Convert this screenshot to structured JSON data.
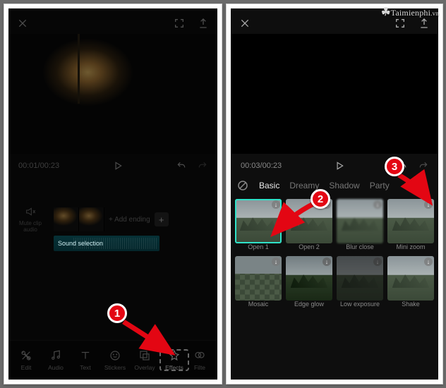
{
  "watermark": "Taimienphi",
  "watermark_suffix": ".vn",
  "left": {
    "time_current": "00:01",
    "time_total": "00:23",
    "mute_label": "Mute clip audio",
    "add_ending": "+ Add ending",
    "audio_clip_label": "Sound selection",
    "tools": {
      "edit": "Edit",
      "audio": "Audio",
      "text": "Text",
      "stickers": "Stickers",
      "overlay": "Overlay",
      "effects": "Effects",
      "filter": "Filte"
    }
  },
  "right": {
    "time_current": "00:03",
    "time_total": "00:23",
    "categories": {
      "basic": "Basic",
      "dreamy": "Dreamy",
      "shadow": "Shadow",
      "party": "Party"
    },
    "effects": {
      "open1": "Open 1",
      "open2": "Open 2",
      "blur_close": "Blur close",
      "mini_zoom": "Mini zoom",
      "mosaic": "Mosaic",
      "edge_glow": "Edge glow",
      "low_exposure": "Low exposure",
      "shake": "Shake"
    }
  },
  "annotations": {
    "b1": "1",
    "b2": "2",
    "b3": "3"
  }
}
